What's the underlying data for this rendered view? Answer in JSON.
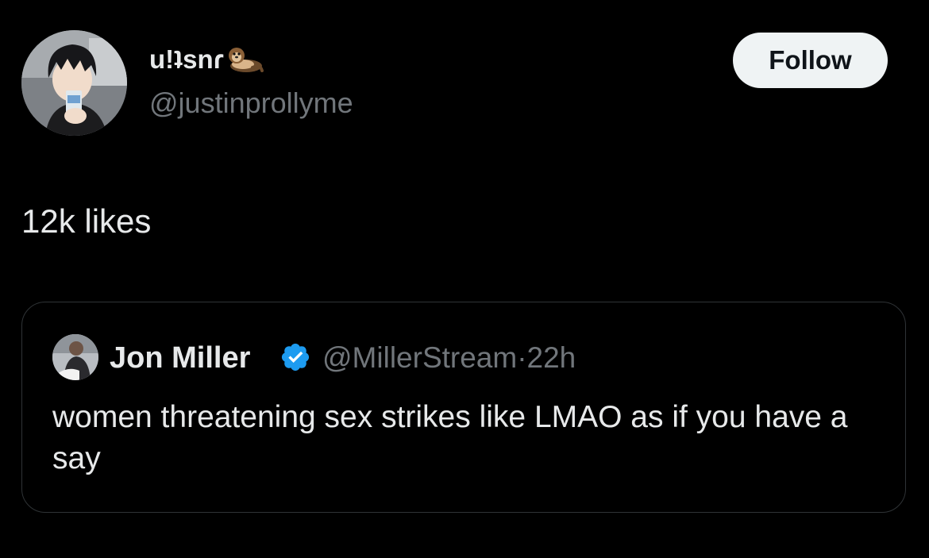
{
  "author": {
    "display_name": "u!ʇsnɾ",
    "emoji": "otter-emoji",
    "handle": "@justinprollyme",
    "avatar": "anime-character-avatar"
  },
  "follow_button": {
    "label": "Follow"
  },
  "tweet": {
    "text": "12k likes"
  },
  "quoted_tweet": {
    "author_name": "Jon Miller",
    "verified": true,
    "handle": "@MillerStream",
    "separator": "·",
    "time": "22h",
    "text": "women threatening sex strikes like LMAO as if you have a say",
    "avatar": "profile-photo-avatar"
  },
  "colors": {
    "background": "#000000",
    "primary_text": "#e7e9ea",
    "secondary_text": "#71767b",
    "verified_badge": "#1d9bf0",
    "border": "#2f3336",
    "button_bg": "#eff3f4"
  }
}
